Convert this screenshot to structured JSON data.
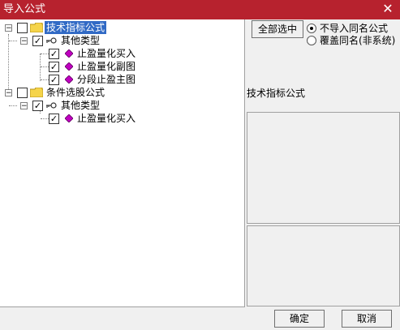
{
  "window": {
    "title": "导入公式",
    "close_icon": "close-icon"
  },
  "tree": {
    "groups": [
      {
        "label": "技术指标公式",
        "selected": true,
        "checked": false,
        "children": [
          {
            "label": "其他类型",
            "checked": true,
            "items": [
              {
                "label": "止盈量化买入",
                "checked": true
              },
              {
                "label": "止盈量化副图",
                "checked": true
              },
              {
                "label": "分段止盈主图",
                "checked": true
              }
            ]
          }
        ]
      },
      {
        "label": "条件选股公式",
        "selected": false,
        "checked": false,
        "children": [
          {
            "label": "其他类型",
            "checked": true,
            "items": [
              {
                "label": "止盈量化买入",
                "checked": true
              }
            ]
          }
        ]
      }
    ]
  },
  "options": {
    "select_all_label": "全部选中",
    "radio_no_import": "不导入同名公式",
    "radio_overwrite": "覆盖同名(非系统)",
    "selected_radio": "no_import"
  },
  "info": {
    "type_label": "技术指标公式"
  },
  "buttons": {
    "ok": "确定",
    "cancel": "取消"
  }
}
